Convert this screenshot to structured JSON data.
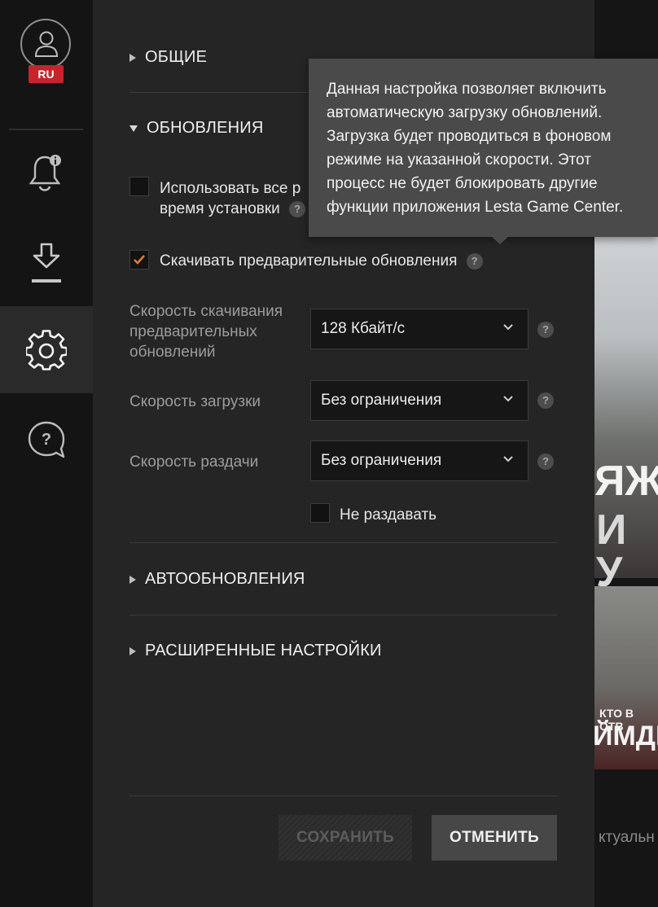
{
  "sidebar": {
    "region": "RU",
    "icons": [
      "user-avatar-icon",
      "notifications-bell-icon",
      "downloads-icon",
      "settings-gear-icon",
      "help-chat-icon"
    ]
  },
  "sections": {
    "general": "ОБЩИЕ",
    "updates": "ОБНОВЛЕНИЯ",
    "autoupdates": "АВТООБНОВЛЕНИЯ",
    "advanced": "РАСШИРЕННЫЕ НАСТРОЙКИ"
  },
  "updates": {
    "use_all_line1": "Использовать все р",
    "use_all_line2": "время установки",
    "use_all_checked": false,
    "preload_label": "Скачивать предварительные обновления",
    "preload_checked": true,
    "preload_speed_label": "Скорость скачивания предварительных обновлений",
    "preload_speed_value": "128 Кбайт/с",
    "download_speed_label": "Скорость загрузки",
    "download_speed_value": "Без ограничения",
    "upload_speed_label": "Скорость раздачи",
    "upload_speed_value": "Без ограничения",
    "no_seed_label": "Не раздавать",
    "no_seed_checked": false
  },
  "help_glyph": "?",
  "buttons": {
    "save": "СОХРАНИТЬ",
    "cancel": "ОТМЕНИТЬ"
  },
  "tooltip": {
    "text": "Данная настройка позволяет включить автоматическую загрузку обновлений. Загрузка будет проводиться в фоновом режиме на указанной скорости. Этот процесс не будет блокировать другие функции приложения Lesta Game Center."
  },
  "background": {
    "promo_text_1": "ЯЖ",
    "promo_text_2": "И У",
    "promo_small": "КТО В ОТВ",
    "promo_big": "ЙМДИ",
    "promo_bottom": "ктуальн"
  },
  "colors": {
    "accent_check": "#e8792e",
    "region_badge": "#c8232c"
  }
}
